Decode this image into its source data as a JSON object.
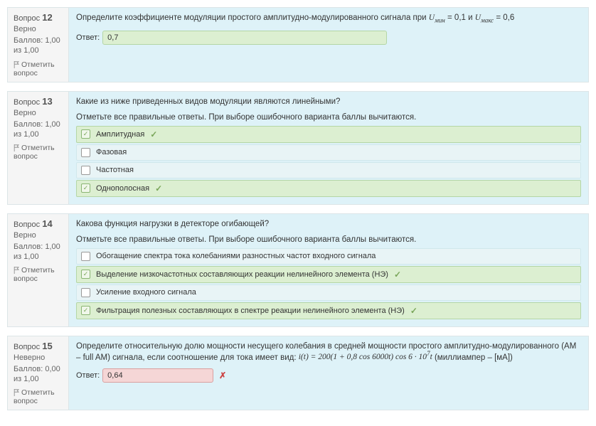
{
  "labels": {
    "question": "Вопрос",
    "flag": "Отметить вопрос",
    "answer": "Ответ:"
  },
  "q12": {
    "num": "12",
    "status": "Верно",
    "marks": "Баллов: 1,00 из 1,00",
    "text": "Определите коэффициенте модуляции простого амплитудно-модулированного сигнала при ",
    "u1": "U",
    "u1s": "мин",
    "eq1": " = 0,1 и ",
    "u2": "U",
    "u2s": "макс",
    "eq2": " = 0,6",
    "answer": "0,7"
  },
  "q13": {
    "num": "13",
    "status": "Верно",
    "marks": "Баллов: 1,00 из 1,00",
    "text": "Какие из ниже приведенных видов модуляции являются линейными?",
    "instr": "Отметьте все правильные ответы. При выборе ошибочного варианта баллы вычитаются.",
    "opts": [
      {
        "t": "Амплитудная",
        "c": true,
        "ok": true
      },
      {
        "t": "Фазовая",
        "c": false,
        "ok": false
      },
      {
        "t": "Частотная",
        "c": false,
        "ok": false
      },
      {
        "t": "Однополосная",
        "c": true,
        "ok": true
      }
    ]
  },
  "q14": {
    "num": "14",
    "status": "Верно",
    "marks": "Баллов: 1,00 из 1,00",
    "text": "Какова функция нагрузки в детекторе огибающей?",
    "instr": "Отметьте все правильные ответы. При выборе ошибочного варианта баллы вычитаются.",
    "opts": [
      {
        "t": "Обогащение спектра тока колебаниями разностных частот входного сигнала",
        "c": false,
        "ok": false
      },
      {
        "t": "Выделение низкочастотных составляющих реакции нелинейного элемента (НЭ)",
        "c": true,
        "ok": true
      },
      {
        "t": "Усиление входного сигнала",
        "c": false,
        "ok": false
      },
      {
        "t": "Фильтрация полезных составляющих в спектре реакции нелинейного элемента (НЭ)",
        "c": true,
        "ok": true
      }
    ]
  },
  "q15": {
    "num": "15",
    "status": "Неверно",
    "marks": "Баллов: 0,00 из 1,00",
    "text1": "Определите относительную долю мощности несущего колебания в средней мощности простого амплитудно-модулированного (АМ – full AM) сигнала, если соотношение для тока имеет вид: ",
    "formula": "i(t) = 200(1 + 0,8 cos 6000t) cos 6 · 10",
    "exp": "7",
    "formula_end": "t",
    "tail": " (миллиампер – [мА])",
    "answer": "0,64"
  }
}
